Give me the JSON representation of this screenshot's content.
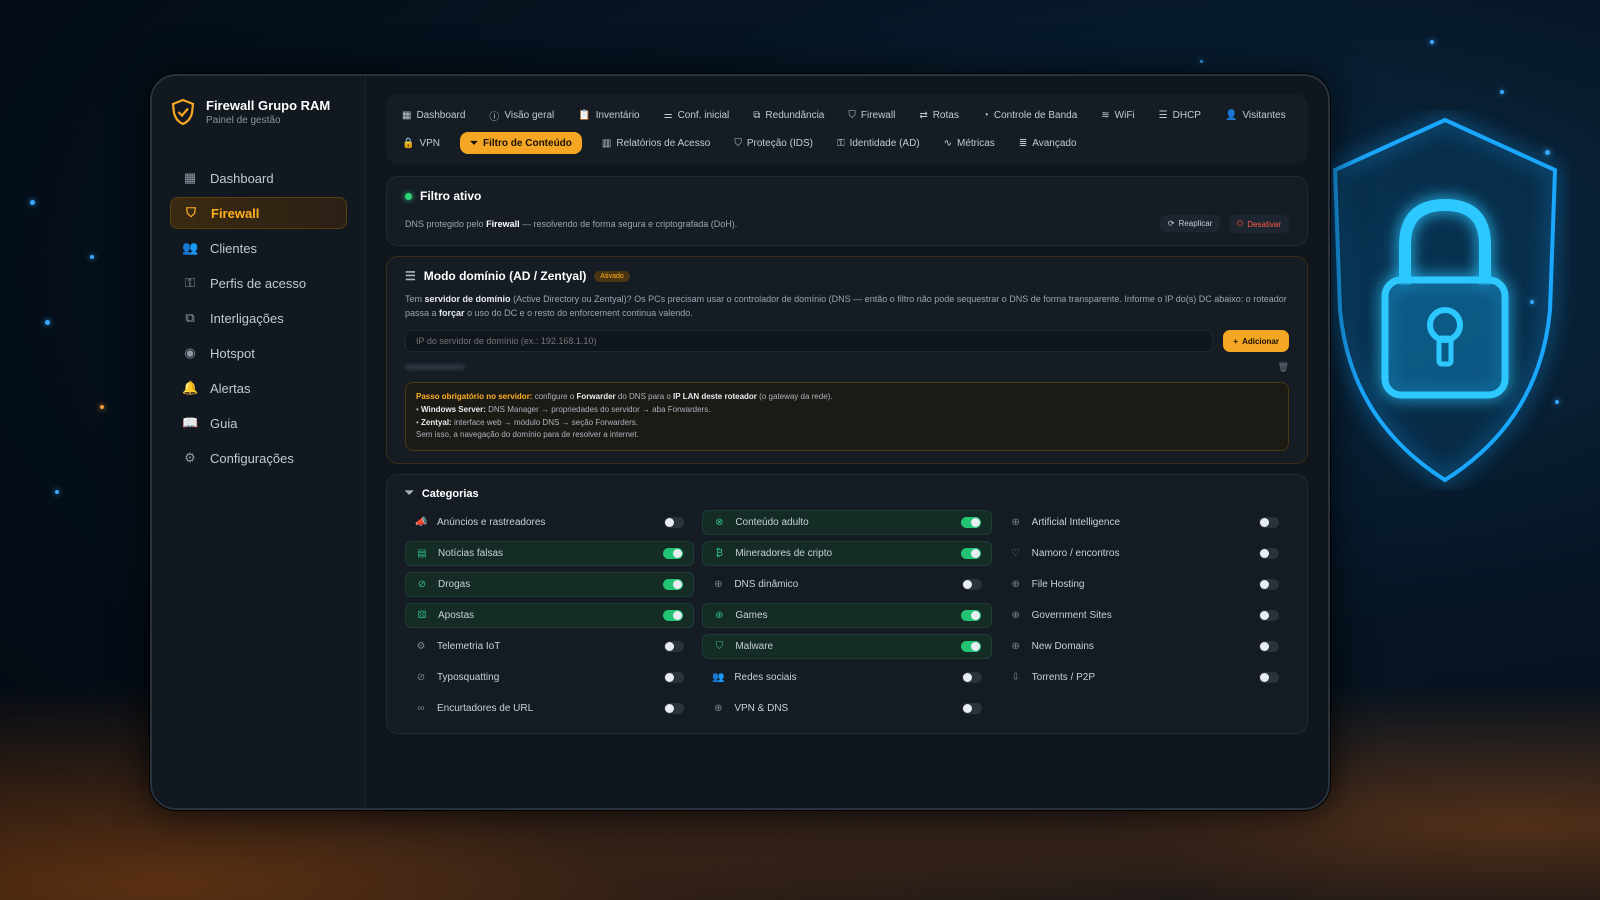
{
  "app": {
    "title": "Firewall Grupo RAM",
    "subtitle": "Painel de gestão"
  },
  "sidebar": {
    "items": [
      {
        "label": "Dashboard",
        "icon": "grid-icon",
        "active": false
      },
      {
        "label": "Firewall",
        "icon": "shield-icon",
        "active": true
      },
      {
        "label": "Clientes",
        "icon": "users-icon",
        "active": false
      },
      {
        "label": "Perfis de acesso",
        "icon": "key-icon",
        "active": false
      },
      {
        "label": "Interligações",
        "icon": "network-icon",
        "active": false
      },
      {
        "label": "Hotspot",
        "icon": "wireless-icon",
        "active": false
      },
      {
        "label": "Alertas",
        "icon": "bell-icon",
        "active": false
      },
      {
        "label": "Guia",
        "icon": "book-icon",
        "active": false
      },
      {
        "label": "Configurações",
        "icon": "gear-icon",
        "active": false
      }
    ]
  },
  "tabs": [
    {
      "label": "Dashboard",
      "icon": "grid-icon"
    },
    {
      "label": "Visão geral",
      "icon": "info-icon"
    },
    {
      "label": "Inventário",
      "icon": "clipboard-icon"
    },
    {
      "label": "Conf. inicial",
      "icon": "sliders-icon"
    },
    {
      "label": "Redundância",
      "icon": "network-icon"
    },
    {
      "label": "Firewall",
      "icon": "shield-icon"
    },
    {
      "label": "Rotas",
      "icon": "route-icon"
    },
    {
      "label": "Controle de Banda",
      "icon": "gauge-icon"
    },
    {
      "label": "WiFi",
      "icon": "wifi-icon"
    },
    {
      "label": "DHCP",
      "icon": "server-icon"
    },
    {
      "label": "Visitantes",
      "icon": "user-icon"
    },
    {
      "label": "VPN",
      "icon": "lock-icon"
    },
    {
      "label": "Filtro de Conteúdo",
      "icon": "filter-icon",
      "active": true
    },
    {
      "label": "Relatórios de Acesso",
      "icon": "chart-icon"
    },
    {
      "label": "Proteção (IDS)",
      "icon": "shield-icon"
    },
    {
      "label": "Identidade (AD)",
      "icon": "key-icon"
    },
    {
      "label": "Métricas",
      "icon": "activity-icon"
    },
    {
      "label": "Avançado",
      "icon": "list-icon"
    }
  ],
  "filter": {
    "status": "Filtro ativo",
    "desc_pre": "DNS protegido pelo",
    "desc_bold": "Firewall",
    "desc_post": "— resolvendo de forma segura e criptografada (DoH).",
    "reapply_label": "Reaplicar",
    "disable_label": "Desativar"
  },
  "domain": {
    "title": "Modo domínio (AD / Zentyal)",
    "badge": "Ativado",
    "text1": "Tem",
    "text_bold1": "servidor de domínio",
    "text2": "(Active Directory ou Zentyal)? Os PCs precisam usar o controlador de domínio (DNS — então o filtro não pode sequestrar o DNS de forma transparente. Informe o IP do(s) DC abaixo: o roteador passa a",
    "text_bold2": "forçar",
    "text3": "o uso do DC e o resto do enforcement continua valendo.",
    "ip_placeholder": "IP do servidor de domínio (ex.: 192.168.1.10)",
    "add_label": "Adicionar",
    "notice": {
      "title": "Passo obrigatório no servidor:",
      "line1_a": "configure o",
      "line1_b": "Forwarder",
      "line1_c": "do DNS para o",
      "line1_d": "IP LAN deste roteador",
      "line1_e": "(o gateway da rede).",
      "line2_b": "Windows Server:",
      "line2_t": "DNS Manager → propriedades do servidor → aba Forwarders.",
      "line3_b": "Zentyal:",
      "line3_t": "interface web → módulo DNS → seção Forwarders.",
      "line4": "Sem isso, a navegação do domínio para de resolver a internet."
    }
  },
  "categories": {
    "title": "Categorias",
    "col1": [
      {
        "label": "Anúncios e rastreadores",
        "icon": "megaphone-icon",
        "on": false
      },
      {
        "label": "Notícias falsas",
        "icon": "newspaper-icon",
        "on": true
      },
      {
        "label": "Drogas",
        "icon": "pill-icon",
        "on": true
      },
      {
        "label": "Apostas",
        "icon": "dice-icon",
        "on": true
      },
      {
        "label": "Telemetria IoT",
        "icon": "chip-icon",
        "on": false
      },
      {
        "label": "Typosquatting",
        "icon": "ban-icon",
        "on": false
      },
      {
        "label": "Encurtadores de URL",
        "icon": "link-icon",
        "on": false
      }
    ],
    "col2": [
      {
        "label": "Conteúdo adulto",
        "icon": "eye-off-icon",
        "on": true
      },
      {
        "label": "Mineradores de cripto",
        "icon": "bitcoin-icon",
        "on": true
      },
      {
        "label": "DNS dinâmico",
        "icon": "globe-icon",
        "on": false
      },
      {
        "label": "Games",
        "icon": "gamepad-icon",
        "on": true
      },
      {
        "label": "Malware",
        "icon": "bug-icon",
        "on": true
      },
      {
        "label": "Redes sociais",
        "icon": "users-icon",
        "on": false
      },
      {
        "label": "VPN & DNS",
        "icon": "globe-icon",
        "on": false
      }
    ],
    "col3": [
      {
        "label": "Artificial Intelligence",
        "icon": "globe-icon",
        "on": false
      },
      {
        "label": "Namoro / encontros",
        "icon": "heart-icon",
        "on": false
      },
      {
        "label": "File Hosting",
        "icon": "globe-icon",
        "on": false
      },
      {
        "label": "Government Sites",
        "icon": "globe-icon",
        "on": false
      },
      {
        "label": "New Domains",
        "icon": "globe-icon",
        "on": false
      },
      {
        "label": "Torrents / P2P",
        "icon": "download-icon",
        "on": false
      }
    ]
  },
  "colors": {
    "accent": "#f5a623",
    "active_green": "#22c473",
    "danger": "#ff5a4a",
    "background": "#10161d"
  }
}
